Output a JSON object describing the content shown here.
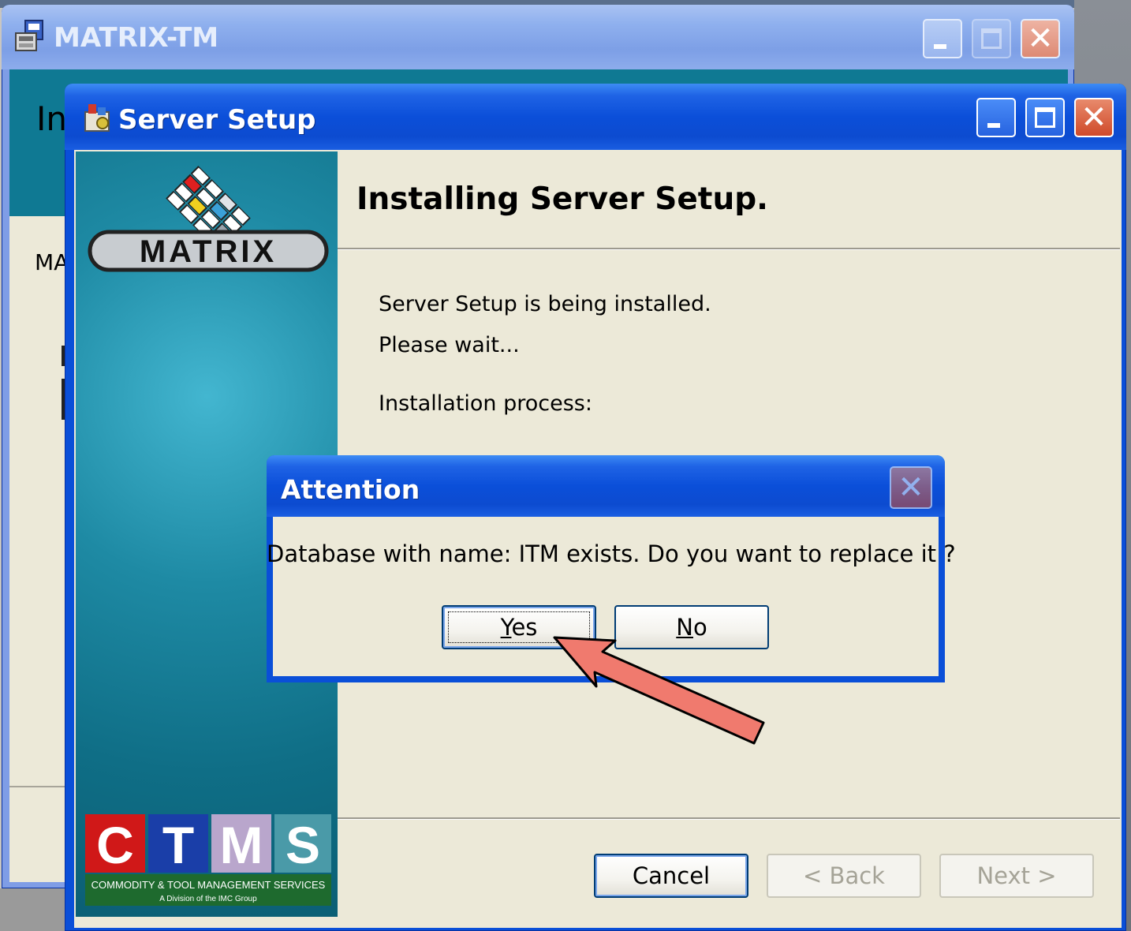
{
  "back_window": {
    "title": "MATRIX-TM",
    "banner_text": "In",
    "body_text": "MA"
  },
  "front_window": {
    "title": "Server Setup",
    "header": "Installing Server Setup.",
    "lines": [
      "Server Setup is being installed.",
      "Please wait...",
      "Installation process:"
    ],
    "buttons": {
      "cancel": "Cancel",
      "back": "< Back",
      "next": "Next >"
    }
  },
  "dialog": {
    "title": "Attention",
    "message": "Database with name: ITM exists. Do you want to replace it ?",
    "yes_first": "Y",
    "yes_rest": "es",
    "no_first": "N",
    "no_rest": "o"
  },
  "logos": {
    "matrix": "MATRIX",
    "ctms_letters": [
      "C",
      "T",
      "M",
      "S"
    ],
    "ctms_tagline": "COMMODITY & TOOL MANAGEMENT SERVICES",
    "ctms_sub": "A Division of the IMC Group"
  },
  "colors": {
    "xp_blue": "#0a4fd8",
    "panel_teal": "#0f7993",
    "arrow": "#f07a6e"
  },
  "icons": [
    "installer-icon",
    "setup-icon",
    "minimize-icon",
    "maximize-icon",
    "close-icon"
  ]
}
